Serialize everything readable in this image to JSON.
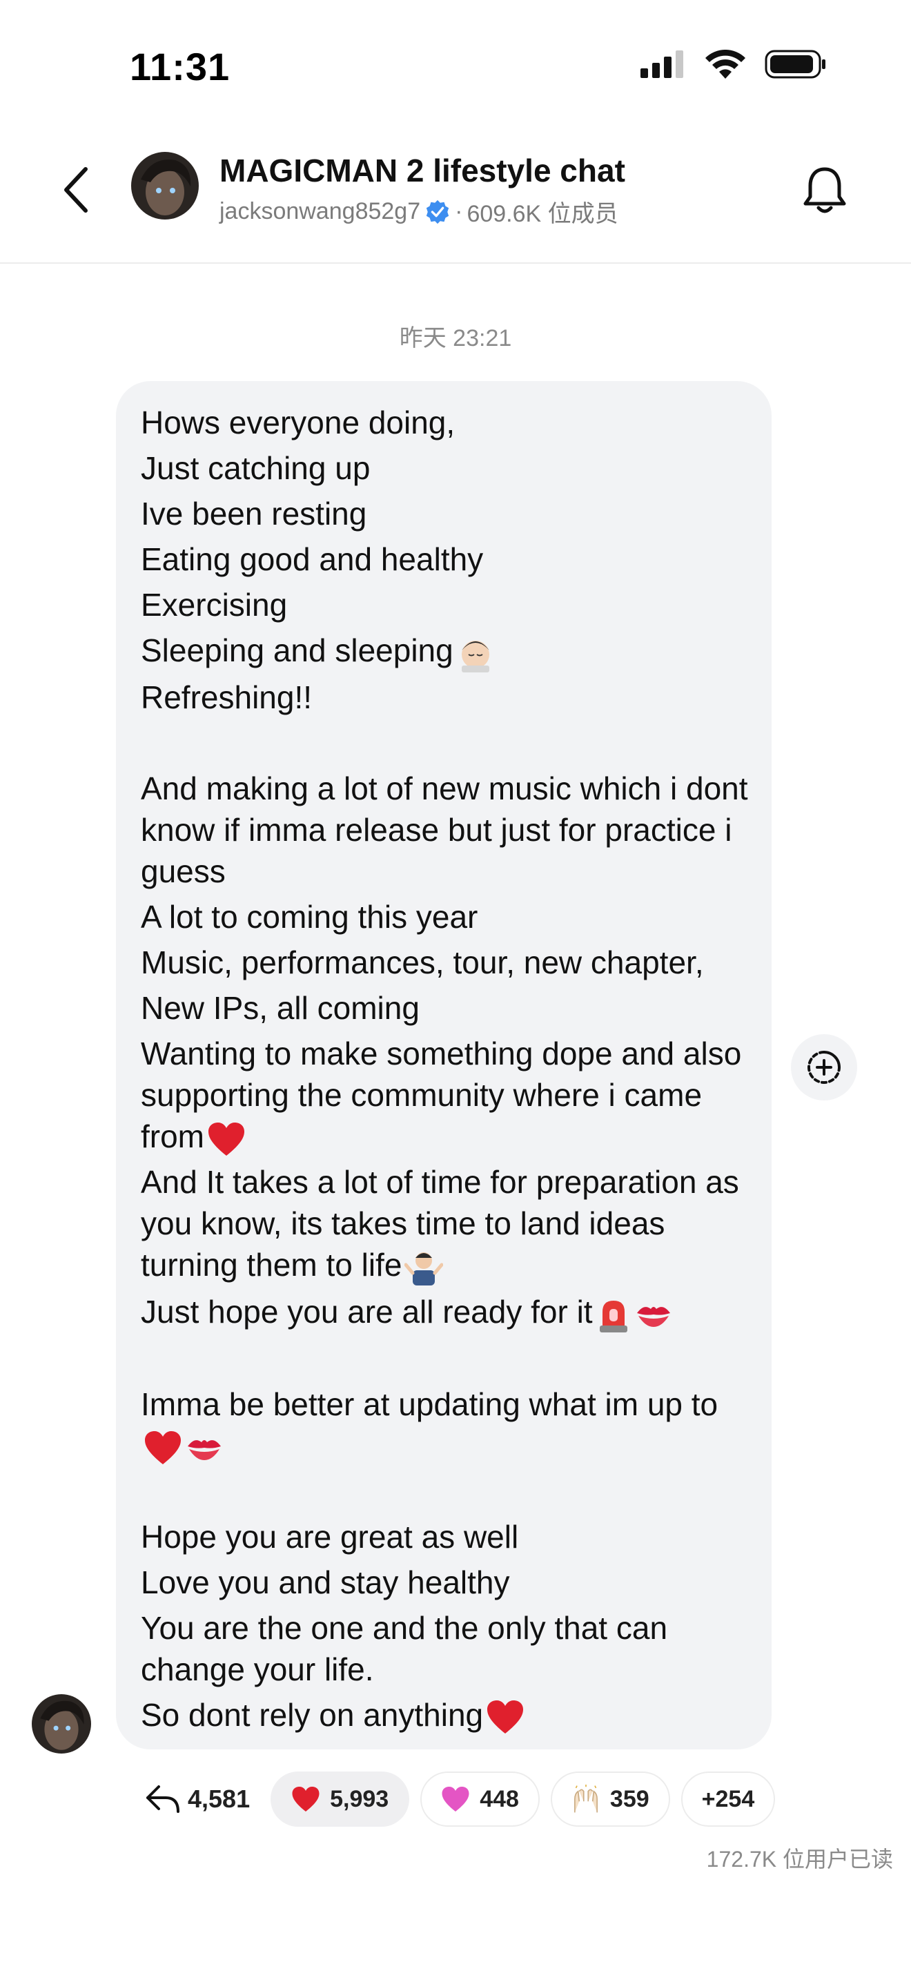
{
  "status_bar": {
    "time": "11:31",
    "icons": [
      "cellular-signal-icon",
      "wifi-icon",
      "battery-icon"
    ]
  },
  "header": {
    "title": "MAGICMAN 2 lifestyle chat",
    "username": "jacksonwang852g7",
    "separator": "·",
    "member_count": "609.6K 位成员",
    "icons": [
      "back-chevron-icon",
      "verified-badge-icon",
      "bell-icon"
    ]
  },
  "timestamp": "昨天 23:21",
  "message": {
    "lines": [
      "Hows everyone doing,",
      "Just catching up",
      "Ive been resting",
      "Eating good and healthy",
      "Exercising",
      "Sleeping and sleeping",
      "Refreshing!!",
      "",
      "And making a lot of new music which i dont know if imma release but just for practice i guess",
      "A lot to coming this year",
      "Music, performances, tour, new chapter,",
      "New IPs, all coming",
      "Wanting to make something dope and also supporting the community where i came from",
      "And It takes a lot of time for preparation as you know, its takes time to land ideas turning them to life",
      "Just hope you are all ready for it",
      "",
      "Imma be better at updating what im up to",
      "",
      "Hope you are great as well",
      "Love you and stay healthy",
      "You are the one and the only that can change your life.",
      "So dont rely on anything"
    ]
  },
  "reactions": {
    "reply_count": "4,581",
    "chips": [
      {
        "emoji": "red-heart",
        "count": "5,993",
        "selected": true
      },
      {
        "emoji": "pink-heart",
        "count": "448",
        "selected": false
      },
      {
        "emoji": "raised-hands",
        "count": "359",
        "selected": false
      }
    ],
    "more": "+254"
  },
  "read_count": "172.7K 位用户已读",
  "colors": {
    "bubble_bg": "#f2f3f5",
    "verified": "#3d8ef0",
    "heart_red": "#e0202d",
    "heart_pink": "#e455c4",
    "muted_text": "#8a8a8a"
  }
}
